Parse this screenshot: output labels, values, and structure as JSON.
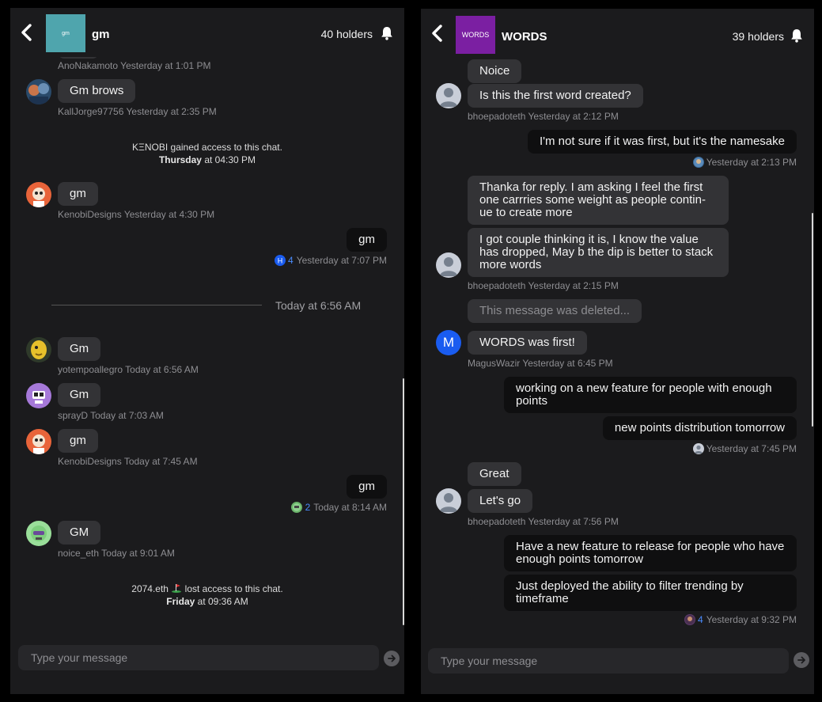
{
  "left": {
    "title": "gm",
    "icon_text": "gm",
    "icon_color": "#4fa5ad",
    "holders": "40 holders",
    "placeholder": "Type your message",
    "messages": {
      "m0_meta": "AnoNakamoto Yesterday at 1:01 PM",
      "m1_text": "Gm brows",
      "m1_meta": "KallJorge97756 Yesterday at 2:35 PM",
      "sys1_line1": "KΞNOBI gained access to this chat.",
      "sys1_day": "Thursday",
      "sys1_time": " at 04:30 PM",
      "m2_text": "gm",
      "m2_meta": "KenobiDesigns Yesterday at 4:30 PM",
      "m3_text": "gm",
      "m3_count": "4",
      "m3_time": "Yesterday at 7:07 PM",
      "divider": "Today at 6:56 AM",
      "m4_text": "Gm",
      "m4_meta": "yotempoallegro Today at 6:56 AM",
      "m5_text": "Gm",
      "m5_meta": "sprayD Today at 7:03 AM",
      "m6_text": "gm",
      "m6_meta": "KenobiDesigns Today at 7:45 AM",
      "m7_text": "gm",
      "m7_count": "2",
      "m7_time": "Today at 8:14 AM",
      "m8_text": "GM",
      "m8_meta": "noice_eth Today at 9:01 AM",
      "sys2_line1a": "2074.eth",
      "sys2_line1b": "lost access to this chat.",
      "sys2_day": "Friday",
      "sys2_time": " at 09:36 AM"
    }
  },
  "right": {
    "title": "WORDS",
    "icon_text": "WORDS",
    "icon_color": "#7b1fa2",
    "holders": "39 holders",
    "placeholder": "Type your message",
    "messages": {
      "r1_text": "Noice",
      "r2_text": "Is this the first word created?",
      "r2_meta": "bhoepadoteth Yesterday at 2:12 PM",
      "r3_text": "I'm not sure if it was first, but it's the namesake",
      "r3_time": "Yesterday at 2:13 PM",
      "r4_text": "Thanka for reply. I am asking I feel the first one carrries some weight as people contin-ue to create more",
      "r5_text": "I got couple thinking it is, I know the value has dropped, May b the dip is better to stack more words",
      "r5_meta": "bhoepadoteth Yesterday at 2:15 PM",
      "r6_text": "This message was deleted...",
      "r7_text": "WORDS was first!",
      "r7_avatar": "M",
      "r7_meta": "MagusWazir Yesterday at 6:45 PM",
      "r8_text": "working on a new feature for people with enough points",
      "r9_text": "new points distribution tomorrow",
      "r9_time": "Yesterday at 7:45 PM",
      "r10_text": "Great",
      "r11_text": "Let's go",
      "r11_meta": "bhoepadoteth Yesterday at 7:56 PM",
      "r12_text": "Have a new feature to release for people who have enough points tomorrow",
      "r13_text": "Just deployed the ability to filter trending by timeframe",
      "r13_count": "4",
      "r13_time": "Yesterday at 9:32 PM"
    }
  },
  "colors": {
    "panel_bg": "#1b1b1d",
    "bubble_other": "#333336",
    "bubble_me": "#0f0f10",
    "link_blue": "#4a8cff",
    "avatar_m": "#1a5cf0"
  },
  "icons": [
    "back-icon",
    "bell-icon",
    "send-icon",
    "avatar-icon"
  ]
}
